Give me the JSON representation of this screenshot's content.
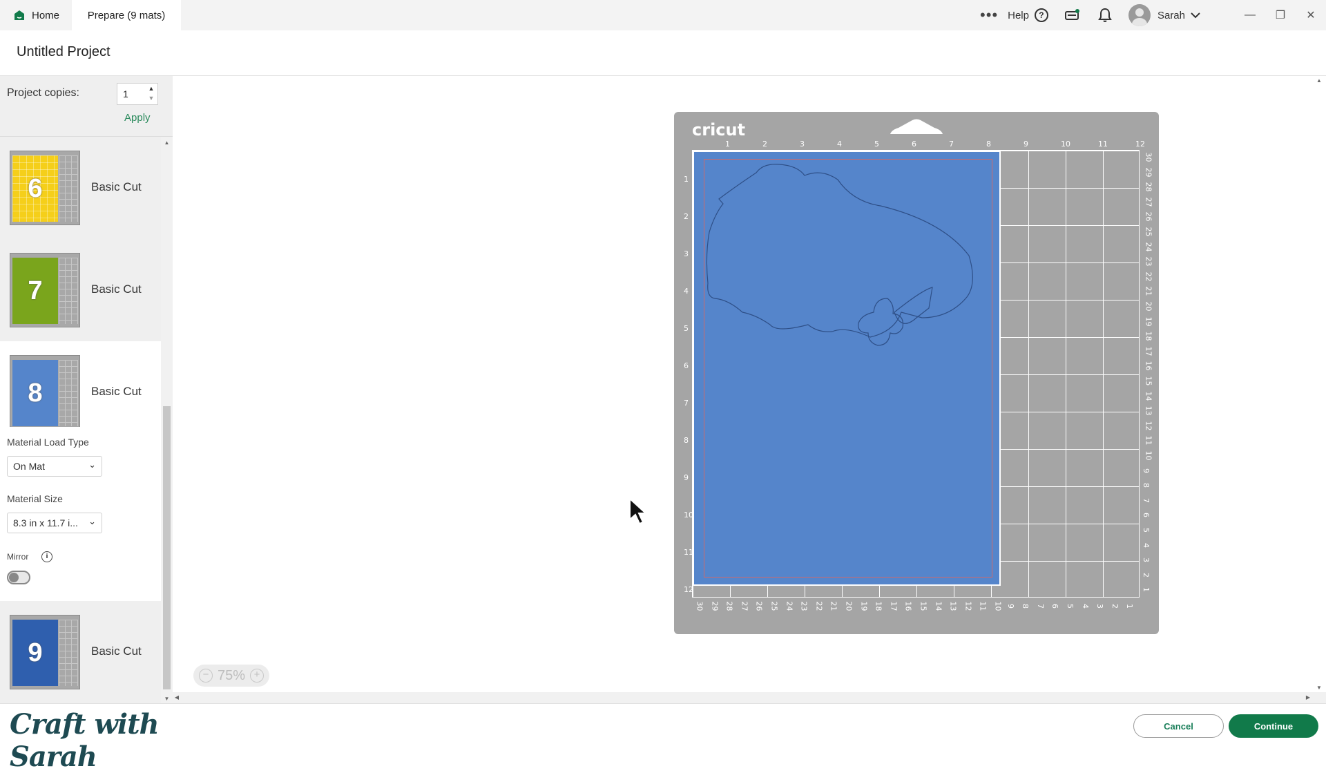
{
  "tabs": {
    "home_label": "Home",
    "prepare_label": "Prepare (9 mats)"
  },
  "topbar": {
    "more_icon": "ellipsis-icon",
    "help_label": "Help",
    "help_glyph": "?",
    "user_name": "Sarah",
    "colors": {
      "brand": "#117a4a",
      "accent": "#2a8a5c"
    }
  },
  "project": {
    "title": "Untitled Project"
  },
  "sidebar": {
    "copies_label": "Project copies:",
    "copies_value": "1",
    "apply_label": "Apply",
    "mats": [
      {
        "number": "6",
        "label": "Basic Cut",
        "color": "#f5cf1a"
      },
      {
        "number": "7",
        "label": "Basic Cut",
        "color": "#7aa51c"
      },
      {
        "number": "8",
        "label": "Basic Cut",
        "color": "#5585cb"
      },
      {
        "number": "9",
        "label": "Basic Cut",
        "color": "#2f5fae"
      }
    ],
    "load_type_label": "Material Load Type",
    "load_type_value": "On Mat",
    "size_label": "Material Size",
    "size_value": "8.3 in x 11.7 i...",
    "mirror_label": "Mirror",
    "mirror_on": false
  },
  "canvas": {
    "brand": "cricut",
    "top_ruler": [
      "1",
      "2",
      "3",
      "4",
      "5",
      "6",
      "7",
      "8",
      "9",
      "10",
      "11",
      "12"
    ],
    "left_ruler": [
      "1",
      "2",
      "3",
      "4",
      "5",
      "6",
      "7",
      "8",
      "9",
      "10",
      "11",
      "12"
    ],
    "bottom_ruler": [
      "30",
      "29",
      "28",
      "27",
      "26",
      "25",
      "24",
      "23",
      "22",
      "21",
      "20",
      "19",
      "18",
      "17",
      "16",
      "15",
      "14",
      "13",
      "12",
      "11",
      "10",
      "9",
      "8",
      "7",
      "6",
      "5",
      "4",
      "3",
      "2",
      "1"
    ],
    "right_ruler": [
      "30",
      "29",
      "28",
      "27",
      "26",
      "25",
      "24",
      "23",
      "22",
      "21",
      "20",
      "19",
      "18",
      "17",
      "16",
      "15",
      "14",
      "13",
      "12",
      "11",
      "10",
      "9",
      "8",
      "7",
      "6",
      "5",
      "4",
      "3",
      "2",
      "1"
    ],
    "material_color": "#5585cb",
    "zoom_value": "75%"
  },
  "footer": {
    "brand_text": "Craft with Sarah",
    "cancel_label": "Cancel",
    "continue_label": "Continue"
  }
}
